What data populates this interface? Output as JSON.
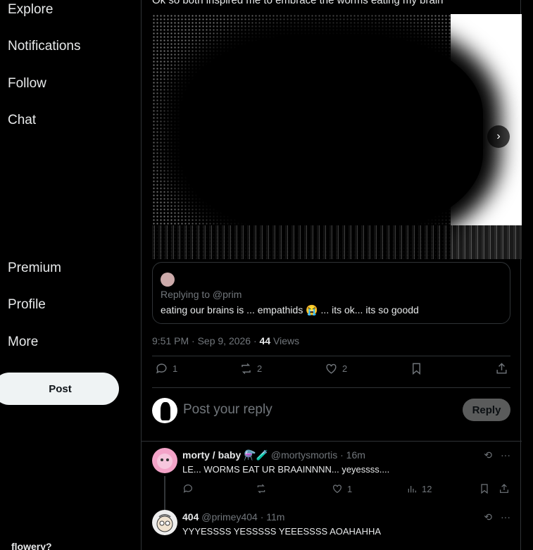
{
  "sidebar": {
    "items": [
      {
        "label": "Explore"
      },
      {
        "label": "Notifications"
      },
      {
        "label": "Follow"
      },
      {
        "label": "Chat"
      },
      {
        "label": "Premium"
      },
      {
        "label": "Profile"
      },
      {
        "label": "More"
      }
    ],
    "post_label": "Post",
    "account_name": "flowery?"
  },
  "tweet": {
    "text": "Ok so both inspired me to embrace the worms eating my brain",
    "quote": {
      "reply_to": "Replying to @prim",
      "text": "eating our brains is ... empathids 😭 ... its ok... its so goodd"
    },
    "time": "9:51 PM · Sep 9, 2026 · ",
    "views_count": "44",
    "views_label": " Views",
    "actions": {
      "replies": "1",
      "reposts": "2",
      "likes": "2"
    }
  },
  "composer": {
    "placeholder": "Post your reply",
    "reply_label": "Reply"
  },
  "replies": [
    {
      "name": "morty / baby ⚗️🧪",
      "handle": "@mortysmortis · 16m",
      "text": "LE... WORMS EAT UR BRAAINNNN... yeyessss....",
      "likes": "1",
      "views": "12"
    },
    {
      "name": "404",
      "handle": "@primey404 · 11m",
      "text": "YYYESSSS YESSSSS YEEESSSS AOAHAHHA"
    }
  ]
}
